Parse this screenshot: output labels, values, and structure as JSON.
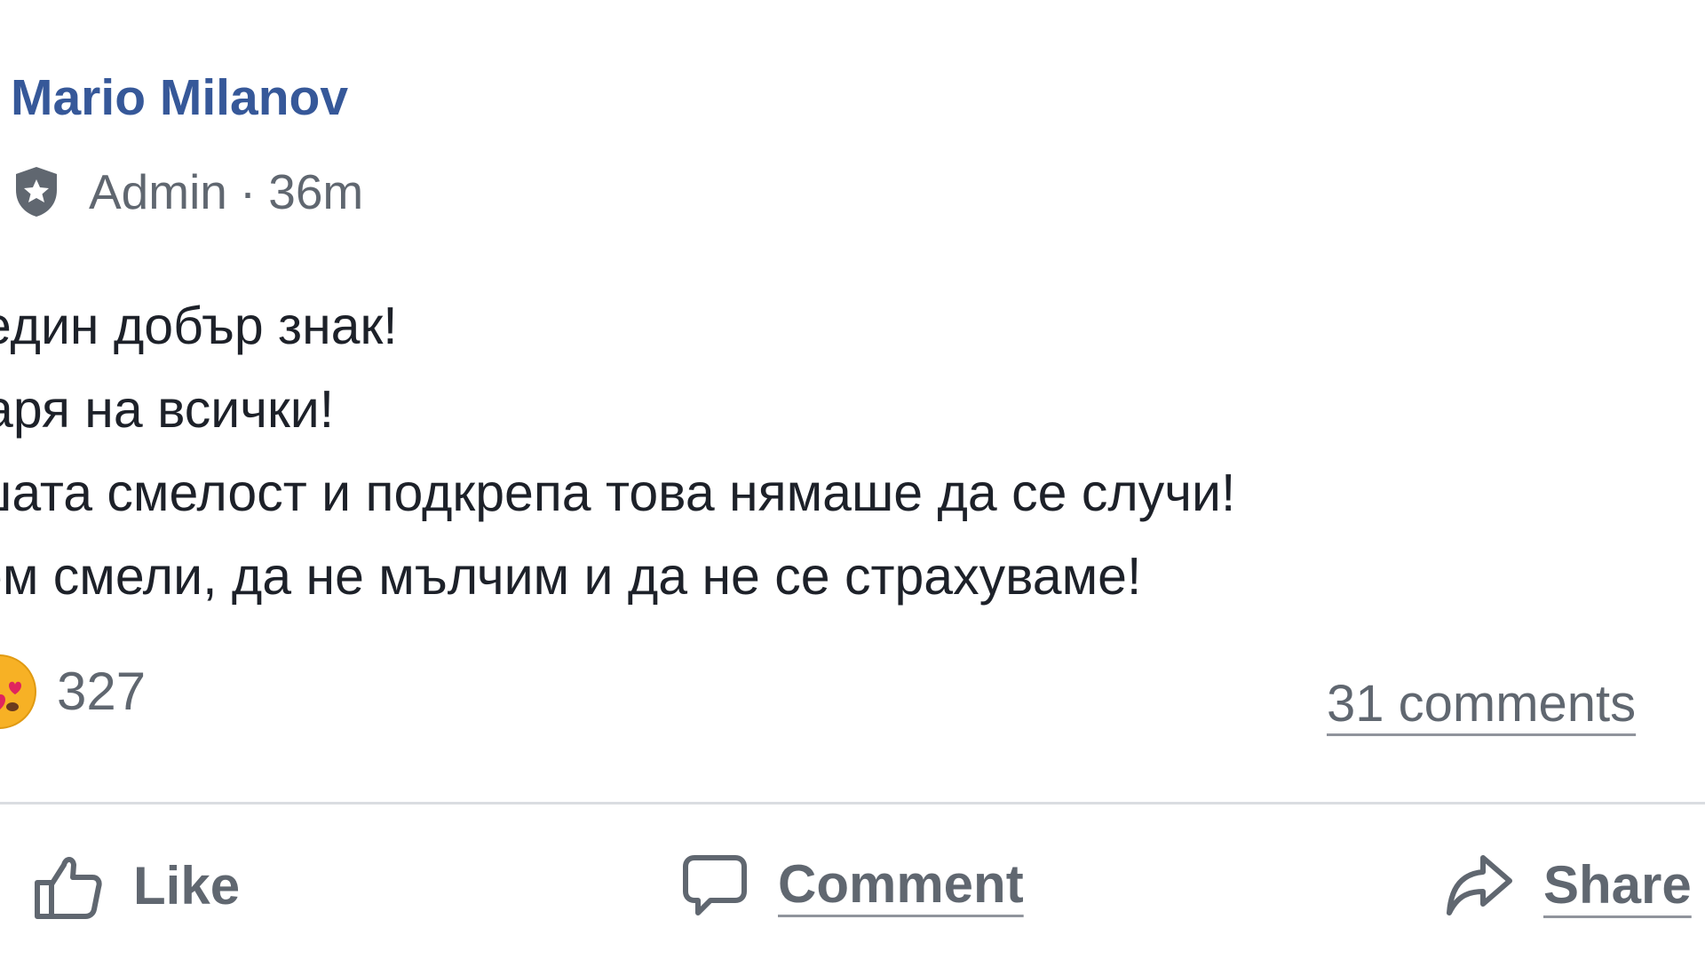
{
  "post": {
    "author": "Mario Milanov",
    "role": "Admin",
    "separator": "·",
    "time": "36m",
    "lines": [
      "един добър знак!",
      "аря на всички!",
      "шата смелост и подкрепа това нямаше да се случи!",
      "ем смели, да не мълчим и да не се страхуваме!"
    ]
  },
  "stats": {
    "reaction_count": "327",
    "comments": "31 comments"
  },
  "actions": {
    "like": "Like",
    "comment": "Comment",
    "share": "Share"
  },
  "icons": {
    "admin": "shield-badge-icon",
    "reaction": "love-emoji-icon",
    "like": "thumbs-up-icon",
    "comment": "speech-bubble-icon",
    "share": "share-arrow-icon"
  },
  "colors": {
    "author": "#365899",
    "meta": "#606770",
    "text": "#1d2129",
    "divider": "#dadde1"
  }
}
